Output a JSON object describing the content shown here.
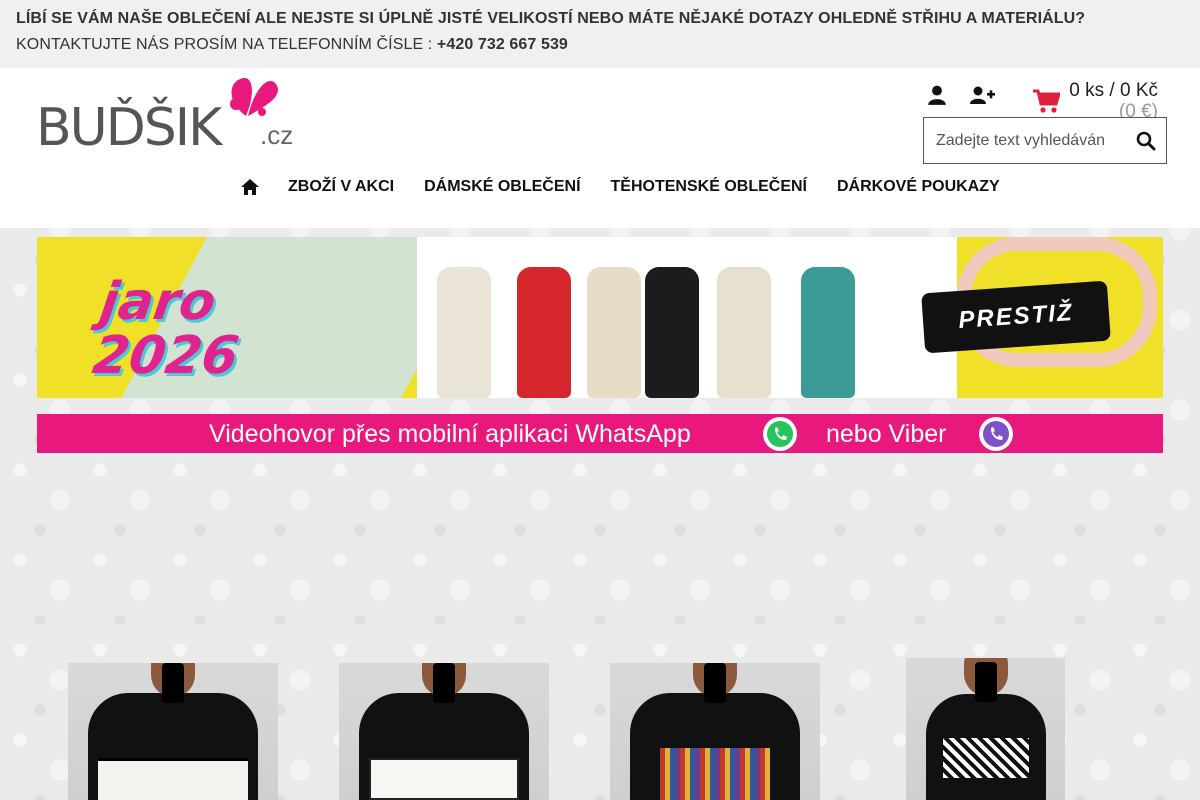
{
  "announcement": {
    "line1": "LÍBÍ SE VÁM NAŠE OBLEČENÍ ALE NEJSTE SI ÚPLNĚ JISTÉ VELIKOSTÍ NEBO MÁTE NĚJAKÉ DOTAZY OHLEDNĚ STŘIHU A MATERIÁLU?",
    "line2_prefix": "KONTAKTUJTE NÁS PROSÍM NA TELEFONNÍM ČÍSLE : ",
    "phone": "+420 732 667 539"
  },
  "logo": {
    "name": "BUĎŠIK",
    "tld": ".cz"
  },
  "account": {
    "login_icon": "user-icon",
    "register_icon": "user-plus-icon"
  },
  "cart": {
    "summary": "0 ks / 0 Kč",
    "eur": "(0 €)",
    "icon": "shopping-cart-icon"
  },
  "search": {
    "placeholder": "Zadejte text vyhledáván",
    "icon": "search-icon"
  },
  "nav": {
    "home_icon": "home-icon",
    "items": [
      "ZBOŽÍ V AKCI",
      "DÁMSKÉ OBLEČENÍ",
      "TĚHOTENSKÉ OBLEČENÍ",
      "DÁRKOVÉ POUKAZY"
    ]
  },
  "hero": {
    "title_line1": "jaro",
    "title_line2": "2026",
    "badge": "PRESTIŽ"
  },
  "video_banner": {
    "text": "Videohovor přes mobilní aplikaci WhatsApp",
    "text2": "nebo Viber"
  },
  "colors": {
    "accent": "#e8187c",
    "banner_yellow": "#f0e028",
    "cart_red": "#e0203a"
  }
}
